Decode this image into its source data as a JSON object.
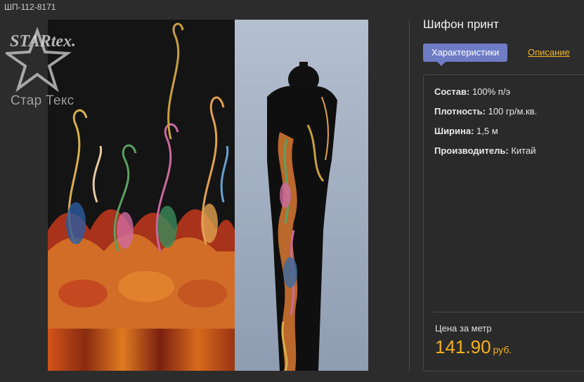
{
  "sku": "ШП-112-8171",
  "logo": {
    "brand": "STARtex.",
    "caption": "Стар Текс"
  },
  "product": {
    "title": "Шифон принт"
  },
  "tabs": {
    "active_label": "Характеристики",
    "other_label": "Описание"
  },
  "specs": [
    {
      "label": "Состав:",
      "value": "100% п/э"
    },
    {
      "label": "Плотность:",
      "value": "100 гр/м.кв."
    },
    {
      "label": "Ширина:",
      "value": "1,5 м"
    },
    {
      "label": "Производитель:",
      "value": "Китай"
    }
  ],
  "price": {
    "label": "Цена за метр",
    "value": "141.90",
    "currency": "руб."
  },
  "colors": {
    "accent_tab": "#6e7cc6",
    "price": "#f5b21a",
    "link": "#f0b82a",
    "background": "#2c2c2c"
  }
}
